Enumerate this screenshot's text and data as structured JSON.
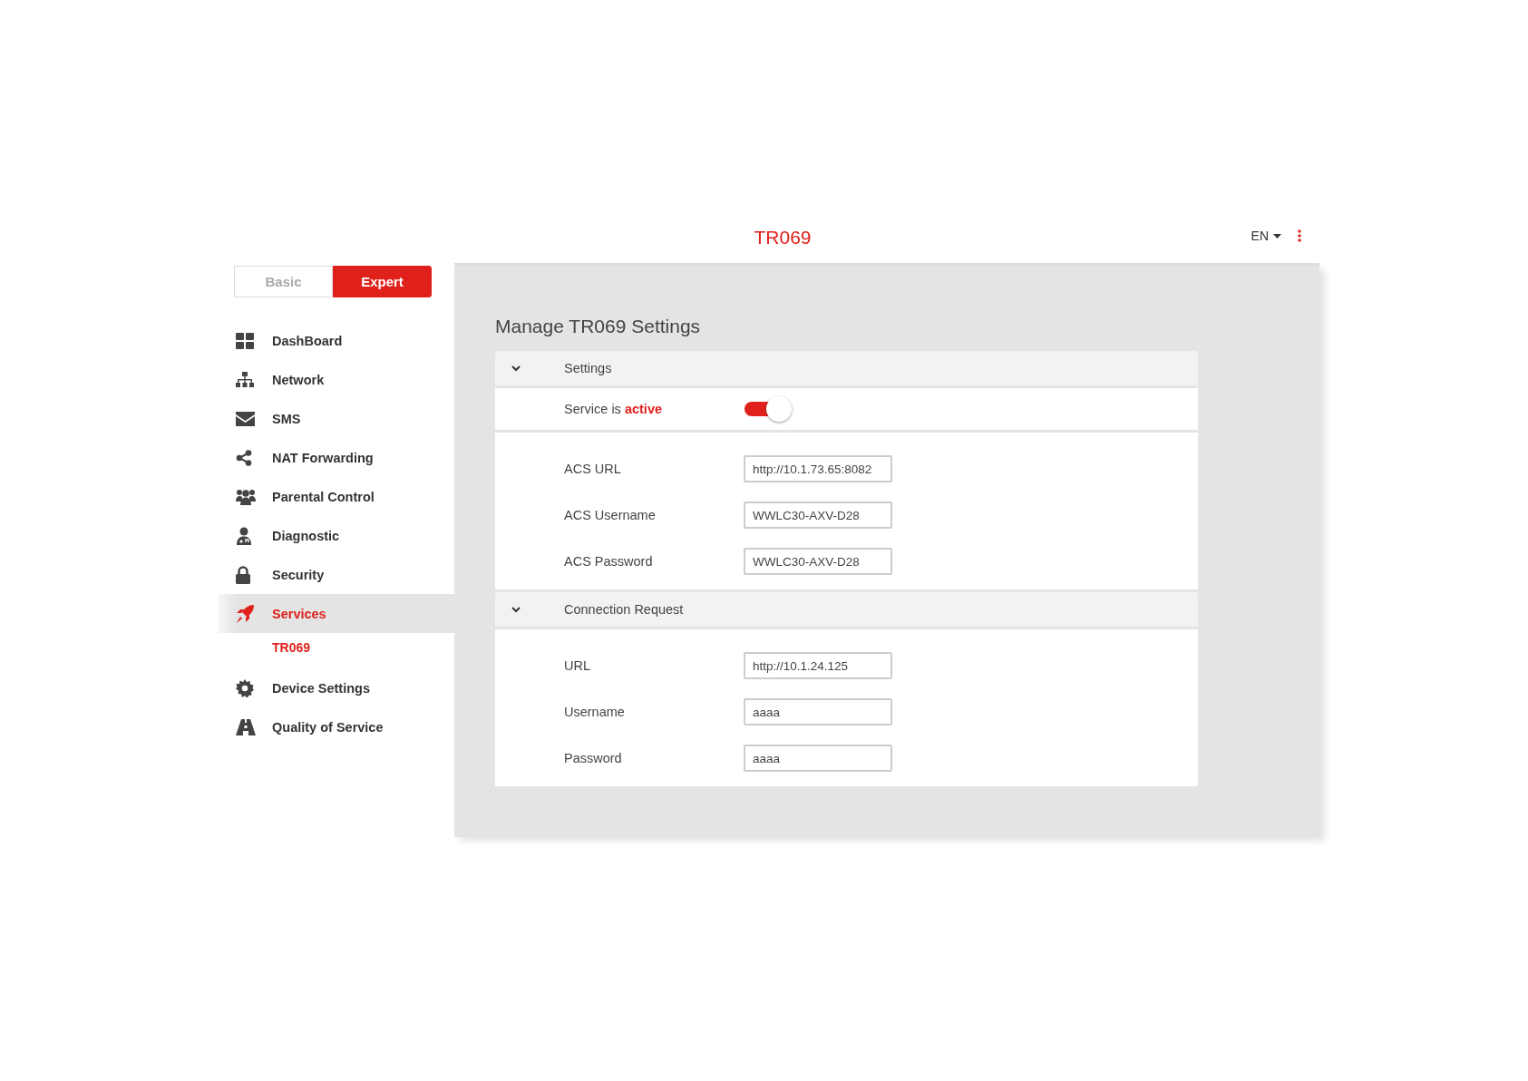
{
  "header": {
    "title": "TR069",
    "language": "EN"
  },
  "mode_switch": [
    {
      "label": "Basic",
      "selected": false
    },
    {
      "label": "Expert",
      "selected": true
    }
  ],
  "sidebar": {
    "items": [
      {
        "label": "DashBoard",
        "selected": false
      },
      {
        "label": "Network",
        "selected": false
      },
      {
        "label": "SMS",
        "selected": false
      },
      {
        "label": "NAT Forwarding",
        "selected": false
      },
      {
        "label": "Parental Control",
        "selected": false
      },
      {
        "label": "Diagnostic",
        "selected": false
      },
      {
        "label": "Security",
        "selected": false
      },
      {
        "label": "Services",
        "selected": true,
        "children": [
          {
            "label": "TR069",
            "selected": true
          }
        ]
      },
      {
        "label": "Device Settings",
        "selected": false
      },
      {
        "label": "Quality of Service",
        "selected": false
      }
    ]
  },
  "page_title": "Manage TR069 Settings",
  "sections": [
    {
      "title": "Settings",
      "expanded": true,
      "toggle": {
        "label": "Service is **active**",
        "on": true
      },
      "fields": [
        {
          "label": "ACS URL",
          "value": "http://10.1.73.65:8082"
        },
        {
          "label": "ACS Username",
          "value": "WWLC30-AXV-D28"
        },
        {
          "label": "ACS Password",
          "value": "WWLC30-AXV-D28"
        }
      ]
    },
    {
      "title": "Connection Request",
      "expanded": true,
      "fields": [
        {
          "label": "URL",
          "value": "http://10.1.24.125"
        },
        {
          "label": "Username",
          "value": "aaaa"
        },
        {
          "label": "Password",
          "value": "aaaa"
        }
      ]
    }
  ]
}
